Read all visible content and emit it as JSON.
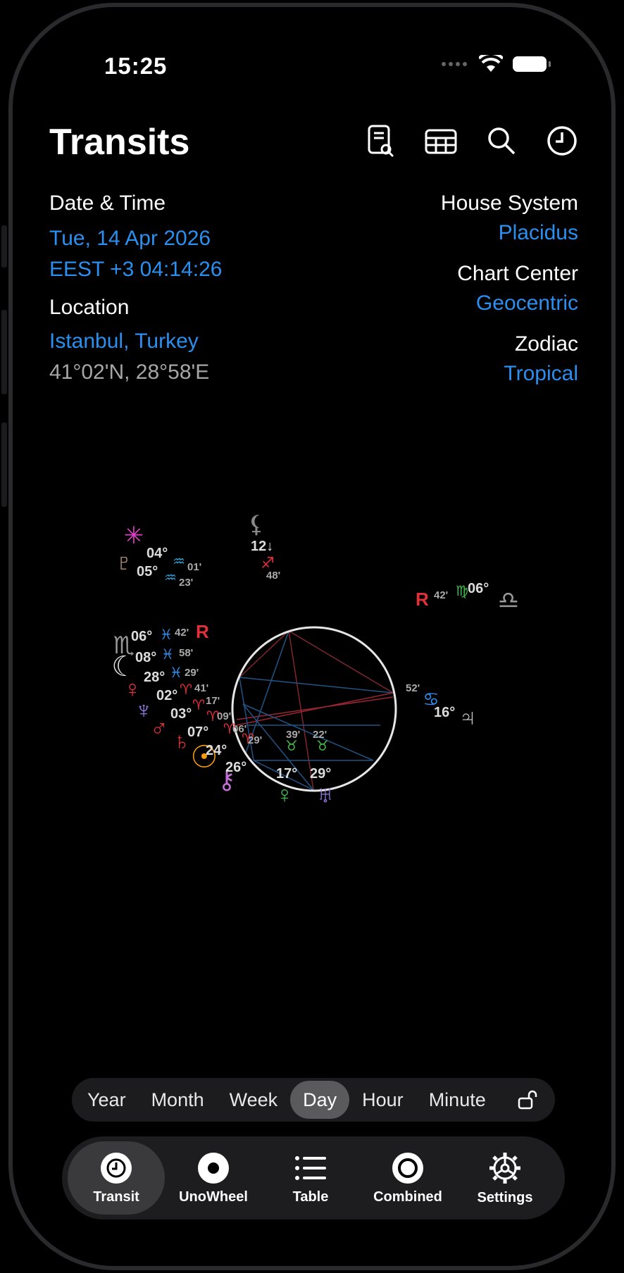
{
  "status": {
    "time": "15:25"
  },
  "header": {
    "title": "Transits"
  },
  "toolbar": [
    {
      "icon": "document-search-icon"
    },
    {
      "icon": "table-icon"
    },
    {
      "icon": "search-icon"
    },
    {
      "icon": "clock-icon"
    }
  ],
  "info": {
    "date_label": "Date & Time",
    "date_value": "Tue, 14 Apr 2026",
    "time_value": "EEST +3 04:14:26",
    "location_label": "Location",
    "location_value": "Istanbul, Turkey",
    "coordinates": "41°02'N, 28°58'E",
    "house_label": "House System",
    "house_value": "Placidus",
    "center_label": "Chart Center",
    "center_value": "Geocentric",
    "zodiac_label": "Zodiac",
    "zodiac_value": "Tropical"
  },
  "chart": {
    "labels": {
      "l1": "12↓",
      "l2": "48'",
      "l3": "04°",
      "l4": "01'",
      "l5": "05°",
      "l6": "23'",
      "l7": "42'",
      "l8": "06°",
      "l9": "06°",
      "l10": "42'",
      "l11": "08°",
      "l12": "58'",
      "l13": "28°",
      "l14": "29'",
      "l15": "02°",
      "l16": "41'",
      "l17": "03°",
      "l18": "17'",
      "l19": "09'",
      "l20": "07°",
      "l21": "06'",
      "l22": "29'",
      "l23": "24°",
      "l24": "26°",
      "l25": "39'",
      "l26": "22'",
      "l27": "17°",
      "l28": "29°",
      "l29": "52'",
      "l30": "16°"
    },
    "retrograde": "R",
    "colors": {
      "red": "#e0303a",
      "blue": "#2f8ff0",
      "green": "#3fbf4a",
      "magenta": "#e03fc8",
      "orange": "#f59a12",
      "violet": "#9a7ae8",
      "pink": "#c56fd8"
    }
  },
  "segments": {
    "items": [
      "Year",
      "Month",
      "Week",
      "Day",
      "Hour",
      "Minute"
    ],
    "selected": "Day"
  },
  "tabs": [
    {
      "label": "Transit",
      "icon": "clock-icon"
    },
    {
      "label": "UnoWheel",
      "icon": "wheel-icon"
    },
    {
      "label": "Table",
      "icon": "list-icon"
    },
    {
      "label": "Combined",
      "icon": "ring-icon"
    },
    {
      "label": "Settings",
      "icon": "gear-icon"
    }
  ]
}
